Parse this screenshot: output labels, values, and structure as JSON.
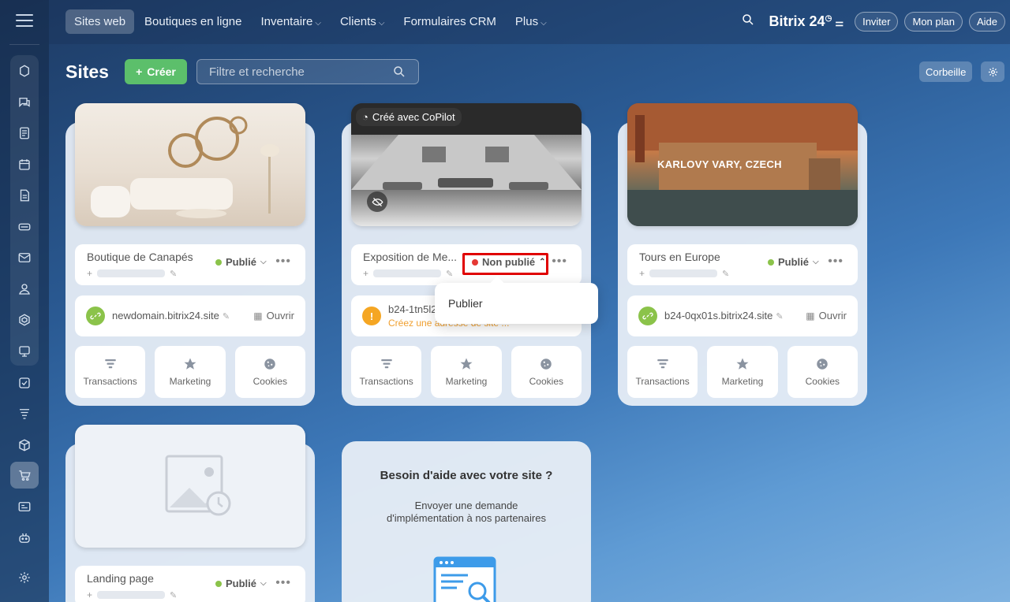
{
  "nav": {
    "items": [
      {
        "label": "Sites web",
        "active": true,
        "has_chevron": false
      },
      {
        "label": "Boutiques en ligne",
        "active": false,
        "has_chevron": false
      },
      {
        "label": "Inventaire",
        "active": false,
        "has_chevron": true
      },
      {
        "label": "Clients",
        "active": false,
        "has_chevron": true
      },
      {
        "label": "Formulaires CRM",
        "active": false,
        "has_chevron": false
      },
      {
        "label": "Plus",
        "active": false,
        "has_chevron": true
      }
    ],
    "brand": "Bitrix 24",
    "invite_label": "Inviter",
    "plan_label": "Mon plan",
    "help_label": "Aide"
  },
  "sidebar": {
    "icons": [
      "recent-icon",
      "chat-icon",
      "feed-icon",
      "calendar-icon",
      "document-icon",
      "drive-icon",
      "mail-icon",
      "contacts-icon",
      "automation-icon",
      "board-icon",
      "tasks-icon",
      "crm-funnel-icon",
      "inventory-box-icon",
      "shop-cart-icon",
      "sites-icon",
      "robot-icon",
      "settings-icon"
    ],
    "active_icon": "shop-cart-icon"
  },
  "header": {
    "title": "Sites",
    "create_label": "Créer",
    "search_placeholder": "Filtre et recherche",
    "trash_label": "Corbeille"
  },
  "colors": {
    "published": "#8bc34a",
    "unpublished": "#e53935",
    "create_button": "#5cbf6b",
    "highlight": "#e00000"
  },
  "cards": [
    {
      "name": "Boutique de Canapés",
      "status": "Publié",
      "domain": "newdomain.bitrix24.site",
      "open_label": "Ouvrir",
      "actions": [
        "Transactions",
        "Marketing",
        "Cookies"
      ]
    },
    {
      "name": "Exposition de Me...",
      "status": "Non publié",
      "copilot_tag": "Créé avec CoPilot",
      "domain": "b24-1tn5l2",
      "domain_warning": "Créez une adresse de site ...",
      "actions": [
        "Transactions",
        "Marketing",
        "Cookies"
      ]
    },
    {
      "name": "Tours en Europe",
      "status": "Publié",
      "thumb_caption": "KARLOVY VARY, CZECH",
      "domain": "b24-0qx01s.bitrix24.site",
      "open_label": "Ouvrir",
      "actions": [
        "Transactions",
        "Marketing",
        "Cookies"
      ]
    },
    {
      "name": "Landing page",
      "status": "Publié"
    }
  ],
  "popup": {
    "publish_label": "Publier"
  },
  "help": {
    "title": "Besoin d'aide avec votre site ?",
    "desc_line1": "Envoyer une demande",
    "desc_line2": "d'implémentation à nos partenaires"
  }
}
